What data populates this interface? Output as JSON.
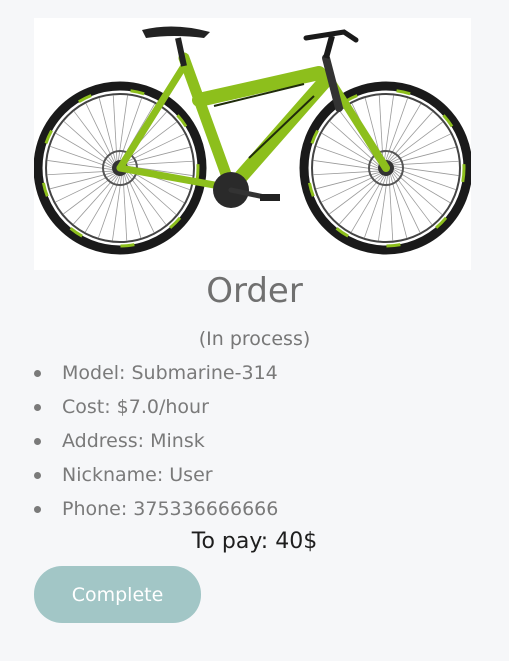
{
  "product": {
    "image_icon": "bicycle-icon",
    "frame_color": "#8dbf1c"
  },
  "order": {
    "title": "Order",
    "status": "(In process)",
    "details": [
      {
        "label": "Model: Submarine-314"
      },
      {
        "label": "Cost: $7.0/hour"
      },
      {
        "label": "Address: Minsk"
      },
      {
        "label": "Nickname: User"
      },
      {
        "label": "Phone: 375336666666"
      }
    ],
    "to_pay": "To pay: 40$",
    "complete_label": "Complete"
  },
  "colors": {
    "background": "#f6f7f9",
    "button": "#a2c6c6",
    "text_muted": "#7a7a7a"
  }
}
